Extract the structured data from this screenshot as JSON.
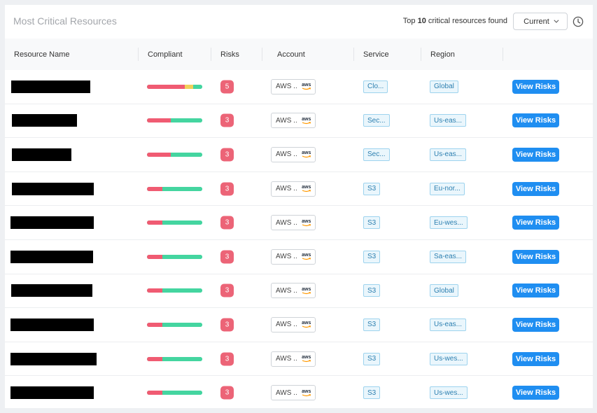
{
  "header": {
    "title": "Most Critical Resources",
    "found_prefix": "Top",
    "found_count": "10",
    "found_suffix": "critical resources found",
    "time_select": "Current"
  },
  "columns": [
    "Resource Name",
    "Compliant",
    "Risks",
    "Account",
    "Service",
    "Region",
    ""
  ],
  "colors": {
    "fail": "#f05b72",
    "warn": "#f1d05a",
    "pass": "#44d5a0",
    "risk_badge": "#ec6477",
    "primary": "#1f8ef1"
  },
  "rows": [
    {
      "name_redacted": true,
      "compliance": {
        "fail": 0.68,
        "warn": 0.15,
        "pass": 0.17
      },
      "risks": "5",
      "account": "AWS ..",
      "service": "Clo...",
      "region": "Global",
      "action": "View Risks"
    },
    {
      "name_redacted": true,
      "compliance": {
        "fail": 0.43,
        "warn": 0,
        "pass": 0.57
      },
      "risks": "3",
      "account": "AWS ..",
      "service": "Sec...",
      "region": "Us-eas...",
      "action": "View Risks"
    },
    {
      "name_redacted": true,
      "compliance": {
        "fail": 0.43,
        "warn": 0,
        "pass": 0.57
      },
      "risks": "3",
      "account": "AWS ..",
      "service": "Sec...",
      "region": "Us-eas...",
      "action": "View Risks"
    },
    {
      "name_redacted": true,
      "compliance": {
        "fail": 0.28,
        "warn": 0,
        "pass": 0.72
      },
      "risks": "3",
      "account": "AWS ..",
      "service": "S3",
      "region": "Eu-nor...",
      "action": "View Risks"
    },
    {
      "name_redacted": true,
      "compliance": {
        "fail": 0.28,
        "warn": 0,
        "pass": 0.72
      },
      "risks": "3",
      "account": "AWS ..",
      "service": "S3",
      "region": "Eu-wes...",
      "action": "View Risks"
    },
    {
      "name_redacted": true,
      "compliance": {
        "fail": 0.28,
        "warn": 0,
        "pass": 0.72
      },
      "risks": "3",
      "account": "AWS ..",
      "service": "S3",
      "region": "Sa-eas...",
      "action": "View Risks"
    },
    {
      "name_redacted": true,
      "compliance": {
        "fail": 0.28,
        "warn": 0,
        "pass": 0.72
      },
      "risks": "3",
      "account": "AWS ..",
      "service": "S3",
      "region": "Global",
      "action": "View Risks"
    },
    {
      "name_redacted": true,
      "compliance": {
        "fail": 0.28,
        "warn": 0,
        "pass": 0.72
      },
      "risks": "3",
      "account": "AWS ..",
      "service": "S3",
      "region": "Us-eas...",
      "action": "View Risks"
    },
    {
      "name_redacted": true,
      "compliance": {
        "fail": 0.28,
        "warn": 0,
        "pass": 0.72
      },
      "risks": "3",
      "account": "AWS ..",
      "service": "S3",
      "region": "Us-wes...",
      "action": "View Risks"
    },
    {
      "name_redacted": true,
      "compliance": {
        "fail": 0.28,
        "warn": 0,
        "pass": 0.72
      },
      "risks": "3",
      "account": "AWS ..",
      "service": "S3",
      "region": "Us-wes...",
      "action": "View Risks"
    }
  ]
}
